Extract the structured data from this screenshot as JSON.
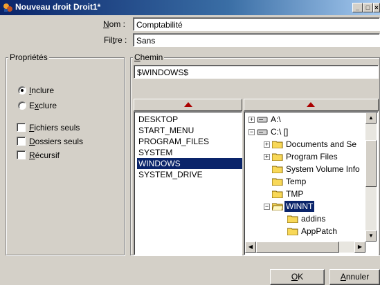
{
  "window": {
    "title": "Nouveau droit Droit1*",
    "controls": {
      "minimize": "_",
      "maximize": "□",
      "close": "×"
    }
  },
  "form": {
    "nom_label": "Nom :",
    "nom_value": "Comptabilité",
    "filtre_label": "Filtre :",
    "filtre_value": "Sans"
  },
  "proprietes": {
    "legend": "Propriétés",
    "radios": [
      {
        "label": "Inclure",
        "selected": true
      },
      {
        "label": "Exclure",
        "selected": false
      }
    ],
    "checkboxes": [
      {
        "label": "Fichiers seuls",
        "checked": false
      },
      {
        "label": "Dossiers seuls",
        "checked": false
      },
      {
        "label": "Récursif",
        "checked": false
      }
    ]
  },
  "chemin": {
    "legend": "Chemin",
    "path_value": "$WINDOWS$",
    "variables": [
      "DESKTOP",
      "START_MENU",
      "PROGRAM_FILES",
      "SYSTEM",
      "WINDOWS",
      "SYSTEM_DRIVE"
    ],
    "selected_variable": "WINDOWS",
    "tree": [
      {
        "label": "A:\\",
        "icon": "floppy-drive-icon"
      },
      {
        "label": "C:\\ []",
        "icon": "hard-drive-icon"
      },
      {
        "label": "Documents and Se",
        "icon": "folder-icon"
      },
      {
        "label": "Program Files",
        "icon": "folder-icon"
      },
      {
        "label": "System Volume Info",
        "icon": "folder-icon"
      },
      {
        "label": "Temp",
        "icon": "folder-icon"
      },
      {
        "label": "TMP",
        "icon": "folder-icon"
      },
      {
        "label": "WINNT",
        "icon": "open-folder-icon",
        "selected": true
      },
      {
        "label": "addins",
        "icon": "folder-icon"
      },
      {
        "label": "AppPatch",
        "icon": "folder-icon"
      }
    ]
  },
  "buttons": {
    "ok": "OK",
    "cancel": "Annuler"
  },
  "colors": {
    "selection": "#0a246a",
    "arrow": "#aa0000",
    "folder": "#f8d858"
  }
}
